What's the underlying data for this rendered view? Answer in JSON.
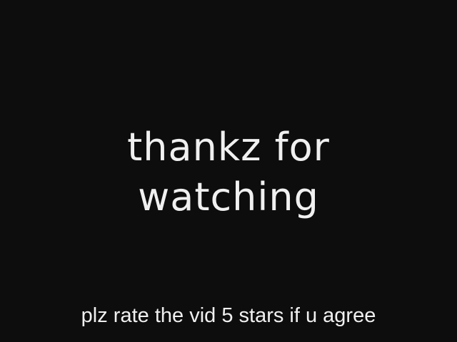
{
  "screen": {
    "headline_line1": "thankz for",
    "headline_line2": "watching",
    "caption": "plz rate the vid 5 stars if u agree"
  },
  "colors": {
    "background": "#0d0d0d",
    "text": "#f0f0f0"
  }
}
